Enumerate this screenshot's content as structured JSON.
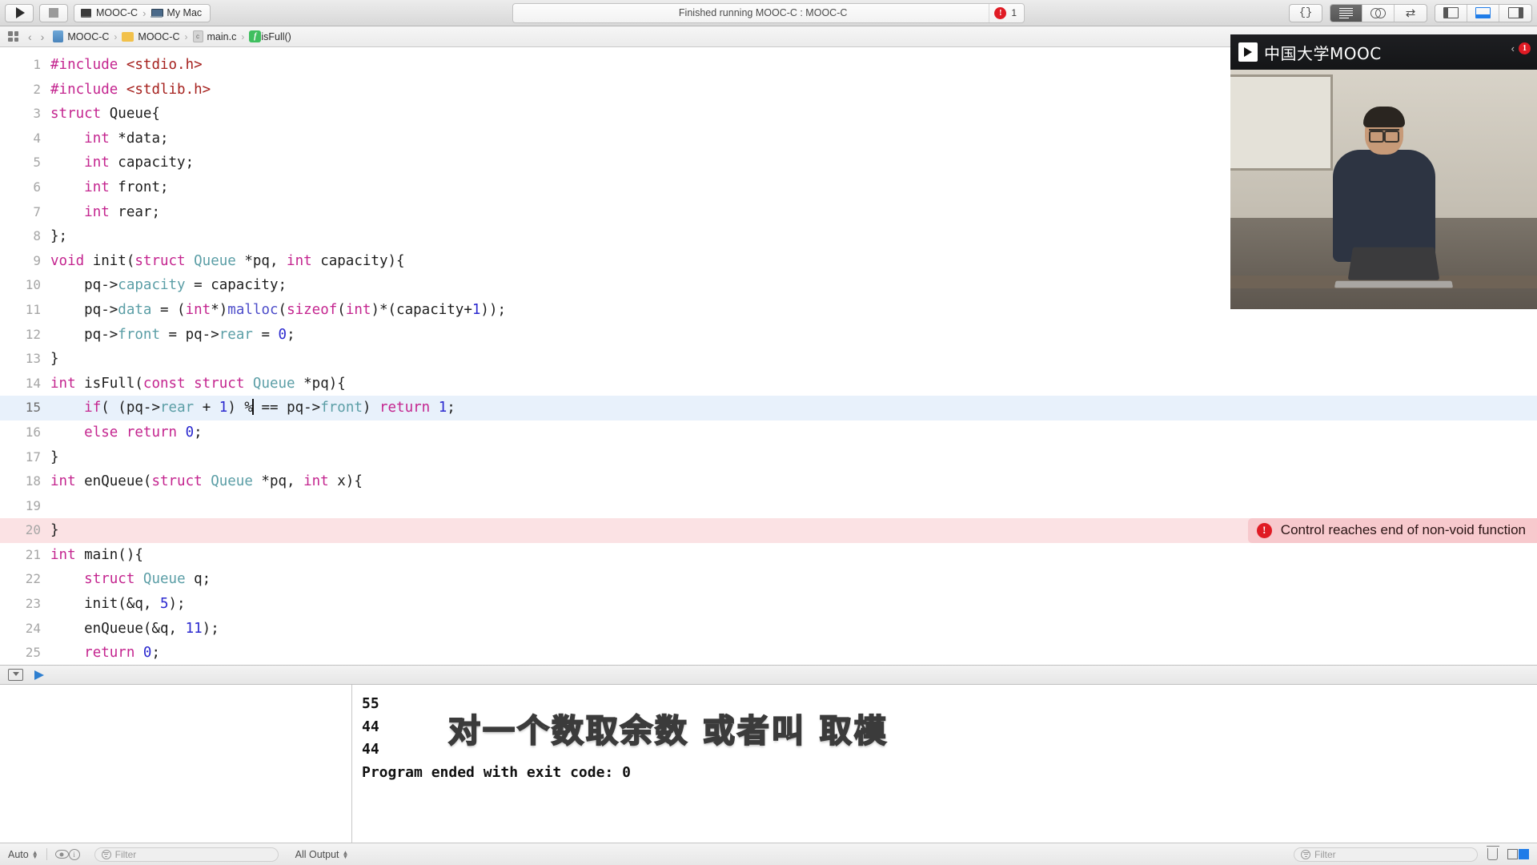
{
  "window": {
    "title": "MOOC-C"
  },
  "toolbar": {
    "run_label": "Run",
    "stop_label": "Stop",
    "scheme_name": "MOOC-C",
    "destination": "My Mac",
    "status_text": "Finished running MOOC-C : MOOC-C",
    "issue_count": "1",
    "braces_label": "{}",
    "editor_standard_label": "Standard Editor",
    "editor_assistant_label": "Assistant Editor",
    "editor_version_label": "Version Editor",
    "panel_left_label": "Navigator",
    "panel_bottom_label": "Debug Area",
    "panel_right_label": "Utilities"
  },
  "jumpbar": {
    "back_label": "‹",
    "forward_label": "›",
    "separator": "›",
    "crumbs": [
      {
        "label": "MOOC-C",
        "icon": "project-icon"
      },
      {
        "label": "MOOC-C",
        "icon": "folder-icon"
      },
      {
        "label": "main.c",
        "icon": "c-file-icon"
      },
      {
        "label": "isFull()",
        "icon": "function-icon"
      }
    ]
  },
  "editor": {
    "current_line": 15,
    "error_line": 20,
    "error_message": "Control reaches end of non-void function",
    "lines": [
      {
        "n": "1",
        "html": "<span class='kw'>#include</span> <span class='str'>&lt;stdio.h&gt;</span>"
      },
      {
        "n": "2",
        "html": "<span class='kw'>#include</span> <span class='str'>&lt;stdlib.h&gt;</span>"
      },
      {
        "n": "3",
        "html": "<span class='kw'>struct</span> Queue{"
      },
      {
        "n": "4",
        "html": "    <span class='kw'>int</span> *data;"
      },
      {
        "n": "5",
        "html": "    <span class='kw'>int</span> capacity;"
      },
      {
        "n": "6",
        "html": "    <span class='kw'>int</span> front;"
      },
      {
        "n": "7",
        "html": "    <span class='kw'>int</span> rear;"
      },
      {
        "n": "8",
        "html": "};"
      },
      {
        "n": "9",
        "html": "<span class='kw'>void</span> init(<span class='kw'>struct</span> <span class='type'>Queue</span> *pq, <span class='kw'>int</span> capacity){"
      },
      {
        "n": "10",
        "html": "    pq-&gt;<span class='memb'>capacity</span> = capacity;"
      },
      {
        "n": "11",
        "html": "    pq-&gt;<span class='memb'>data</span> = (<span class='kw'>int</span>*)<span class='fn'>malloc</span>(<span class='kw'>sizeof</span>(<span class='kw'>int</span>)*(capacity+<span class='num'>1</span>));"
      },
      {
        "n": "12",
        "html": "    pq-&gt;<span class='memb'>front</span> = pq-&gt;<span class='memb'>rear</span> = <span class='num'>0</span>;"
      },
      {
        "n": "13",
        "html": "}"
      },
      {
        "n": "14",
        "html": "<span class='kw'>int</span> isFull(<span class='kw'>const</span> <span class='kw'>struct</span> <span class='type'>Queue</span> *pq){"
      },
      {
        "n": "15",
        "html": "    <span class='kw'>if</span>( (pq-&gt;<span class='memb'>rear</span> + <span class='num'>1</span>) %<span class='caret'></span> == pq-&gt;<span class='memb'>front</span>) <span class='kw'>return</span> <span class='num'>1</span>;"
      },
      {
        "n": "16",
        "html": "    <span class='kw'>else</span> <span class='kw'>return</span> <span class='num'>0</span>;"
      },
      {
        "n": "17",
        "html": "}"
      },
      {
        "n": "18",
        "html": "<span class='kw'>int</span> enQueue(<span class='kw'>struct</span> <span class='type'>Queue</span> *pq, <span class='kw'>int</span> x){"
      },
      {
        "n": "19",
        "html": ""
      },
      {
        "n": "20",
        "html": "}"
      },
      {
        "n": "21",
        "html": "<span class='kw'>int</span> main(){"
      },
      {
        "n": "22",
        "html": "    <span class='kw'>struct</span> <span class='type'>Queue</span> q;"
      },
      {
        "n": "23",
        "html": "    init(&amp;q, <span class='num'>5</span>);"
      },
      {
        "n": "24",
        "html": "    enQueue(&amp;q, <span class='num'>11</span>);"
      },
      {
        "n": "25",
        "html": "    <span class='kw'>return</span> <span class='num'>0</span>;"
      }
    ]
  },
  "console": {
    "output_lines": [
      "55",
      "44",
      "44",
      "Program ended with exit code: 0"
    ],
    "subtitle": "对一个数取余数 或者叫 取模"
  },
  "bottombar": {
    "auto_label": "Auto",
    "filter_placeholder": "Filter",
    "output_scope": "All Output",
    "right_filter_placeholder": "Filter"
  },
  "mooc": {
    "brand": "中国大学MOOC",
    "collapse_label": "‹",
    "badge": "1"
  },
  "colors": {
    "accent_blue": "#1f7ce8",
    "error_red": "#e01b24",
    "keyword_magenta": "#c4258f",
    "string_red": "#a6221f",
    "type_teal": "#5b9ea6",
    "number_blue": "#2b29cf",
    "current_line_bg": "#e8f1fb",
    "error_line_bg": "#fbe2e4"
  }
}
